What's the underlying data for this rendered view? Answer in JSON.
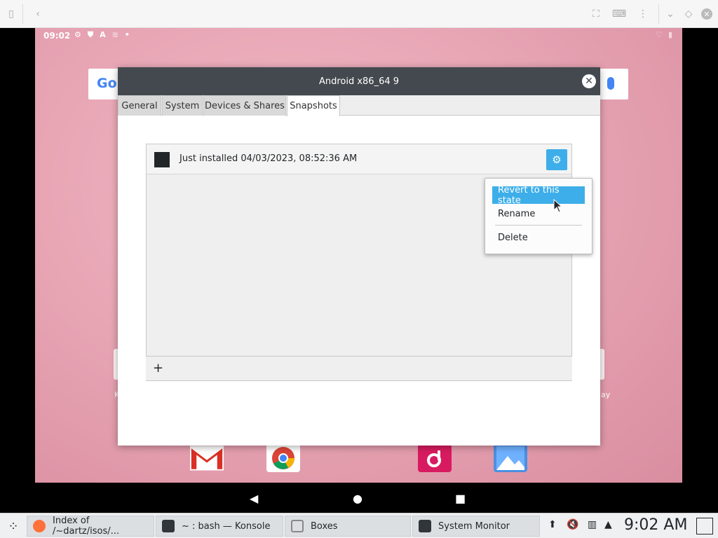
{
  "dialog": {
    "title": "Android x86_64 9",
    "tabs": [
      "General",
      "System",
      "Devices & Shares",
      "Snapshots"
    ],
    "active_tab": "Snapshots",
    "snapshots": [
      {
        "name": "Just installed 04/03/2023, 08:52:36 AM"
      }
    ],
    "add_label": "+"
  },
  "context_menu": {
    "items": [
      "Revert to this state",
      "Rename",
      "Delete"
    ],
    "highlighted": "Revert to this state"
  },
  "android": {
    "status_time": "09:02",
    "search_logo": "Go",
    "side_labels": [
      "K",
      "lay"
    ],
    "dock_icons": [
      "gmail-icon",
      "chrome-icon",
      "music-icon",
      "gallery-icon"
    ]
  },
  "taskbar": {
    "tasks": [
      "Index of /~dartz/isos/...",
      "~ : bash — Konsole",
      "Boxes",
      "System Monitor"
    ],
    "clock": "9:02 AM"
  },
  "colors": {
    "accent": "#3daee9",
    "titlebar": "#44494f",
    "wallpaper": "#e8a6b5"
  }
}
